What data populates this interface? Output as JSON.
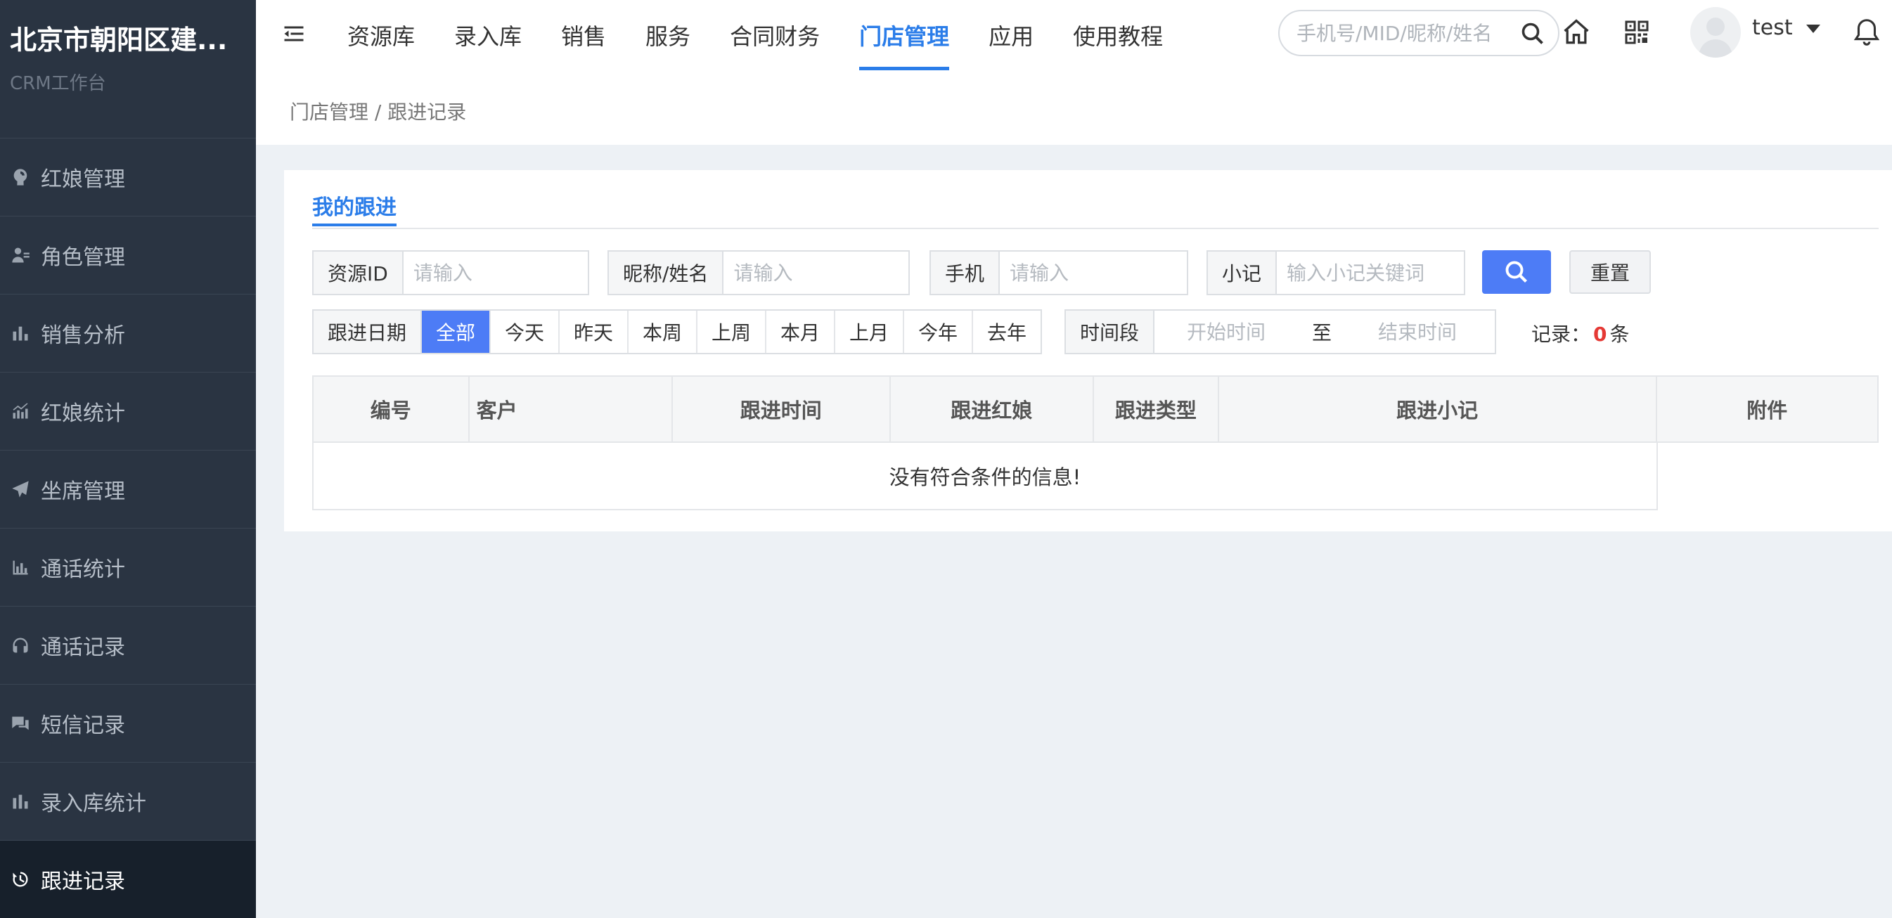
{
  "brand": {
    "title": "北京市朝阳区建...",
    "subtitle": "CRM工作台"
  },
  "sidebar": {
    "items": [
      {
        "label": "红娘管理",
        "icon": "person-icon"
      },
      {
        "label": "角色管理",
        "icon": "user-card-icon"
      },
      {
        "label": "销售分析",
        "icon": "bar-chart-icon"
      },
      {
        "label": "红娘统计",
        "icon": "growth-chart-icon"
      },
      {
        "label": "坐席管理",
        "icon": "paper-plane-icon"
      },
      {
        "label": "通话统计",
        "icon": "bar-chart-icon"
      },
      {
        "label": "通话记录",
        "icon": "headset-icon"
      },
      {
        "label": "短信记录",
        "icon": "chat-icon"
      },
      {
        "label": "录入库统计",
        "icon": "bar-chart-icon"
      },
      {
        "label": "跟进记录",
        "icon": "history-icon",
        "active": true
      }
    ]
  },
  "header": {
    "nav": [
      {
        "label": "资源库"
      },
      {
        "label": "录入库"
      },
      {
        "label": "销售"
      },
      {
        "label": "服务"
      },
      {
        "label": "合同财务"
      },
      {
        "label": "门店管理",
        "active": true
      },
      {
        "label": "应用"
      },
      {
        "label": "使用教程"
      }
    ],
    "search_placeholder": "手机号/MID/昵称/姓名",
    "username": "test"
  },
  "breadcrumb": "门店管理 / 跟进记录",
  "tab": "我的跟进",
  "filters": {
    "resource_id": {
      "label": "资源ID",
      "placeholder": "请输入"
    },
    "nickname": {
      "label": "昵称/姓名",
      "placeholder": "请输入"
    },
    "phone": {
      "label": "手机",
      "placeholder": "请输入"
    },
    "note": {
      "label": "小记",
      "placeholder": "输入小记关键词"
    },
    "reset_label": "重置",
    "date_label": "跟进日期",
    "date_options": [
      "全部",
      "今天",
      "昨天",
      "本周",
      "上周",
      "本月",
      "上月",
      "今年",
      "去年"
    ],
    "date_selected": "全部",
    "period_label": "时间段",
    "start_placeholder": "开始时间",
    "to_label": "至",
    "end_placeholder": "结束时间"
  },
  "records": {
    "prefix": "记录：",
    "count": "0",
    "suffix": "条"
  },
  "table": {
    "columns": [
      "编号",
      "客户",
      "跟进时间",
      "跟进红娘",
      "跟进类型",
      "跟进小记",
      "附件"
    ],
    "empty_message": "没有符合条件的信息!"
  },
  "colors": {
    "accent": "#2b7de9",
    "button": "#4d7cf6",
    "sidebar_bg": "#2a3442",
    "count": "#e53935"
  }
}
